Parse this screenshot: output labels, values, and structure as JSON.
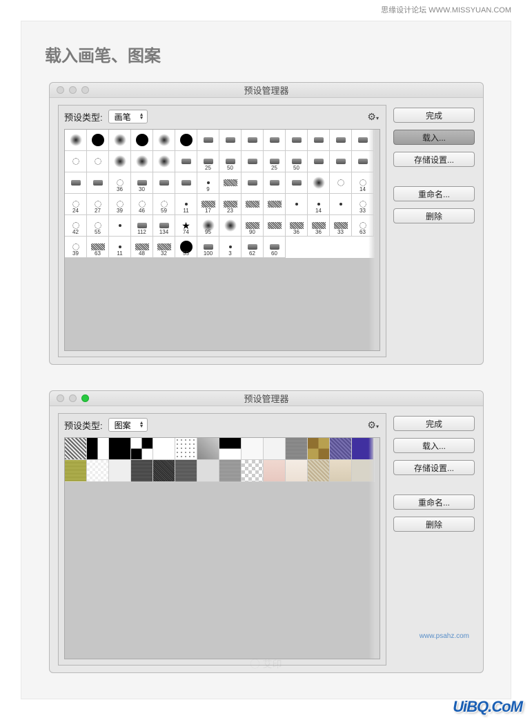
{
  "watermark_top": "思缘设计论坛  WWW.MISSYUAN.COM",
  "watermark_bottom": "UiBQ.CoM",
  "watermark_url": "www.psahz.com",
  "page_title": "载入画笔、图案",
  "dialog_title": "预设管理器",
  "preset_type_label": "预设类型:",
  "dialog1": {
    "select_value": "画笔",
    "buttons": {
      "done": "完成",
      "load": "载入...",
      "save": "存储设置...",
      "rename": "重命名...",
      "delete": "删除"
    },
    "brushes": [
      {
        "n": "",
        "t": "soft"
      },
      {
        "n": "",
        "t": "hard"
      },
      {
        "n": "",
        "t": "soft"
      },
      {
        "n": "",
        "t": "hard"
      },
      {
        "n": "",
        "t": "soft"
      },
      {
        "n": "",
        "t": "hard"
      },
      {
        "n": "",
        "t": "tip"
      },
      {
        "n": "",
        "t": "tip"
      },
      {
        "n": "",
        "t": "tip"
      },
      {
        "n": "",
        "t": "tip"
      },
      {
        "n": "",
        "t": "tip"
      },
      {
        "n": "",
        "t": "tip"
      },
      {
        "n": "",
        "t": "tip"
      },
      {
        "n": "",
        "t": "tip"
      },
      {
        "n": "",
        "t": "spray"
      },
      {
        "n": "",
        "t": "spray"
      },
      {
        "n": "",
        "t": "soft"
      },
      {
        "n": "",
        "t": "soft"
      },
      {
        "n": "",
        "t": "soft"
      },
      {
        "n": "",
        "t": "tip"
      },
      {
        "n": "25",
        "t": "tip"
      },
      {
        "n": "50",
        "t": "tip"
      },
      {
        "n": "",
        "t": "tip"
      },
      {
        "n": "25",
        "t": "tip"
      },
      {
        "n": "50",
        "t": "tip"
      },
      {
        "n": "",
        "t": "tip"
      },
      {
        "n": "",
        "t": "tip"
      },
      {
        "n": "",
        "t": "tip"
      },
      {
        "n": "",
        "t": "tip"
      },
      {
        "n": "",
        "t": "tip"
      },
      {
        "n": "36",
        "t": "spray"
      },
      {
        "n": "30",
        "t": "tip"
      },
      {
        "n": "",
        "t": "tip"
      },
      {
        "n": "",
        "t": "tip"
      },
      {
        "n": "9",
        "t": "dot"
      },
      {
        "n": "",
        "t": "tex"
      },
      {
        "n": "",
        "t": "tip"
      },
      {
        "n": "",
        "t": "tip"
      },
      {
        "n": "",
        "t": "tip"
      },
      {
        "n": "",
        "t": "soft"
      },
      {
        "n": "",
        "t": "spray"
      },
      {
        "n": "14",
        "t": "spray"
      },
      {
        "n": "24",
        "t": "spray"
      },
      {
        "n": "27",
        "t": "spray"
      },
      {
        "n": "39",
        "t": "spray"
      },
      {
        "n": "46",
        "t": "spray"
      },
      {
        "n": "59",
        "t": "spray"
      },
      {
        "n": "11",
        "t": "dot"
      },
      {
        "n": "17",
        "t": "tex"
      },
      {
        "n": "23",
        "t": "tex"
      },
      {
        "n": "",
        "t": "tex"
      },
      {
        "n": "",
        "t": "tex"
      },
      {
        "n": "",
        "t": "dot"
      },
      {
        "n": "14",
        "t": "dot"
      },
      {
        "n": "",
        "t": "dot"
      },
      {
        "n": "33",
        "t": "spray"
      },
      {
        "n": "42",
        "t": "spray"
      },
      {
        "n": "55",
        "t": "spray"
      },
      {
        "n": "",
        "t": "dot"
      },
      {
        "n": "112",
        "t": "tip"
      },
      {
        "n": "134",
        "t": "tip"
      },
      {
        "n": "74",
        "t": "star"
      },
      {
        "n": "95",
        "t": "soft"
      },
      {
        "n": "",
        "t": "soft"
      },
      {
        "n": "90",
        "t": "tex"
      },
      {
        "n": "",
        "t": "tex"
      },
      {
        "n": "36",
        "t": "tex"
      },
      {
        "n": "36",
        "t": "tex"
      },
      {
        "n": "33",
        "t": "tex"
      },
      {
        "n": "63",
        "t": "spray"
      },
      {
        "n": "39",
        "t": "spray"
      },
      {
        "n": "63",
        "t": "tex"
      },
      {
        "n": "11",
        "t": "dot"
      },
      {
        "n": "48",
        "t": "tex"
      },
      {
        "n": "32",
        "t": "tex"
      },
      {
        "n": "55",
        "t": "hard"
      },
      {
        "n": "100",
        "t": "tip"
      },
      {
        "n": "3",
        "t": "dot"
      },
      {
        "n": "62",
        "t": "tip"
      },
      {
        "n": "60",
        "t": "tip"
      }
    ]
  },
  "dialog2": {
    "select_value": "图案",
    "buttons": {
      "done": "完成",
      "load": "载入...",
      "save": "存储设置...",
      "rename": "重命名...",
      "delete": "删除"
    },
    "patterns_count": 28
  }
}
